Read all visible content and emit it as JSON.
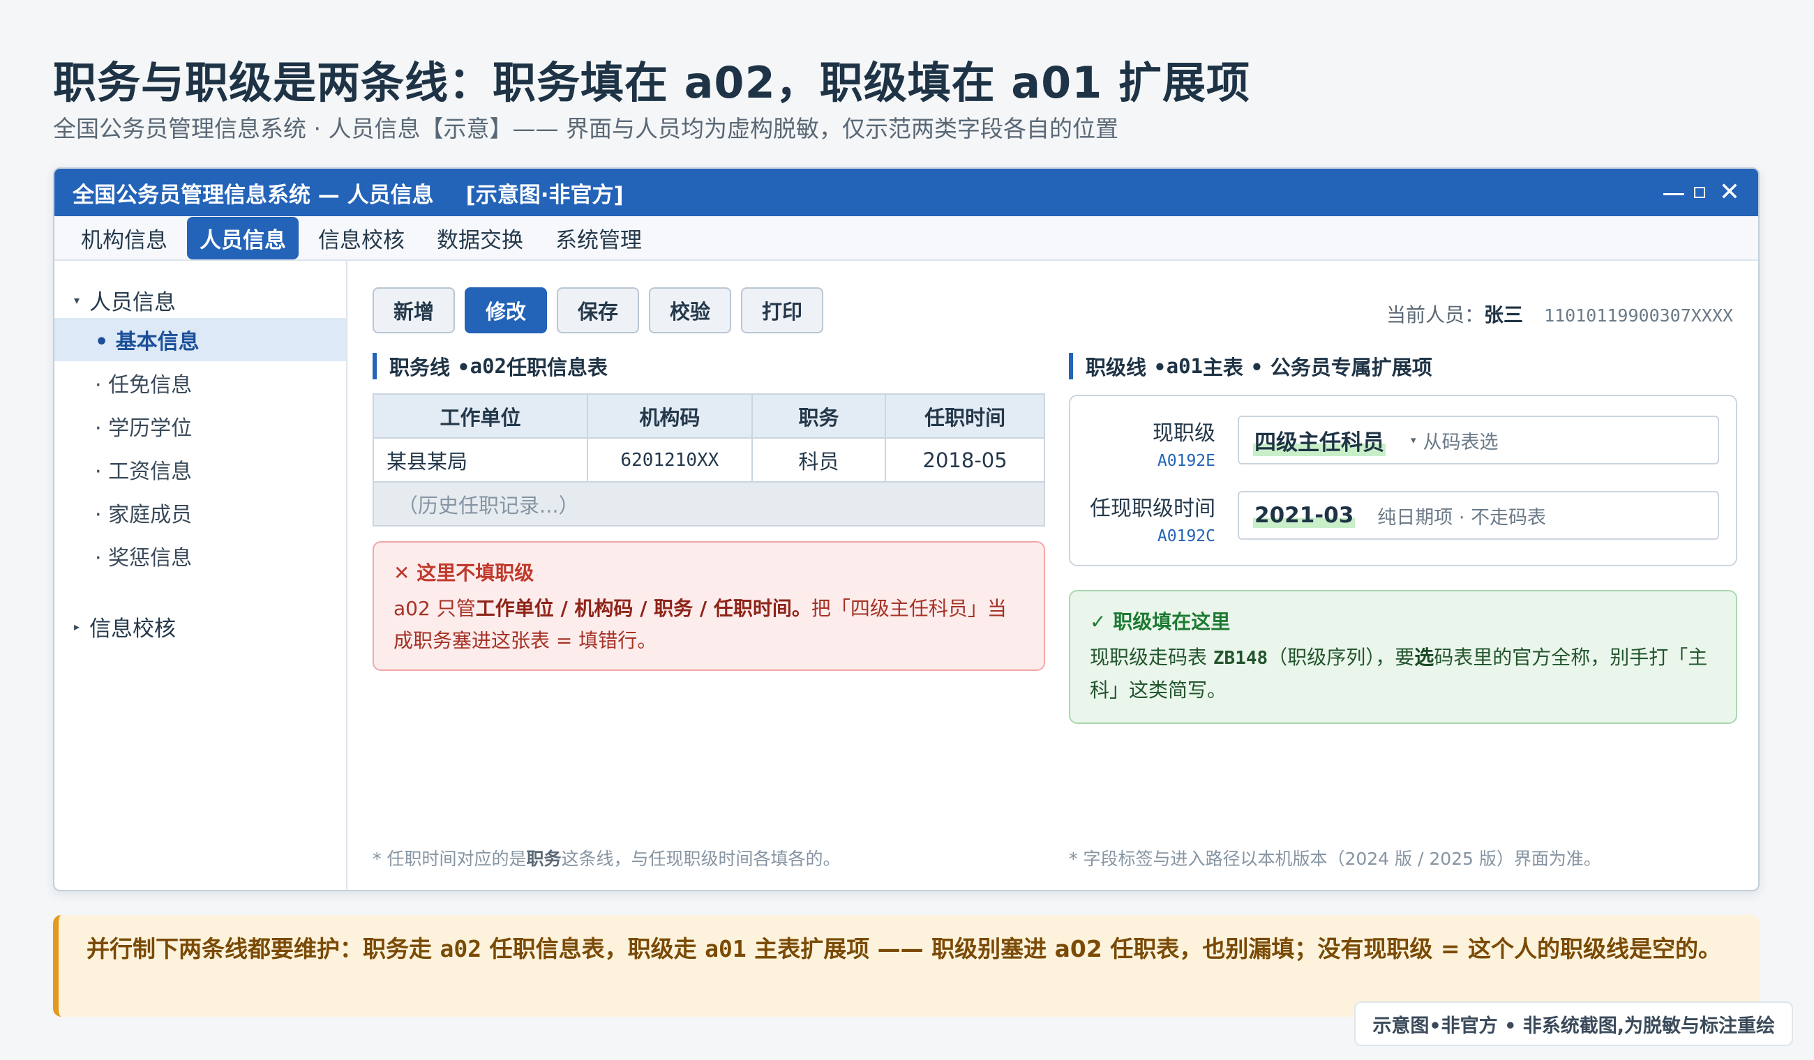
{
  "page": {
    "title": "职务与职级是两条线：职务填在 a02，职级填在 a01 扩展项",
    "subtitle": "全国公务员管理信息系统 · 人员信息【示意】—— 界面与人员均为虚构脱敏，仅示范两类字段各自的位置"
  },
  "window": {
    "title": "全国公务员管理信息系统 — 人员信息",
    "tag": "[示意图·非官方]",
    "close_glyph": "✕"
  },
  "menu": {
    "items": [
      "机构信息",
      "人员信息",
      "信息校核",
      "数据交换",
      "系统管理"
    ],
    "active_index": 1
  },
  "sidebar": {
    "root1": "人员信息",
    "children": [
      "• 基本信息",
      "· 任免信息",
      "· 学历学位",
      "· 工资信息",
      "· 家庭成员",
      "· 奖惩信息"
    ],
    "active_index": 0,
    "root2": "信息校核",
    "caret_open": "▾",
    "caret_closed": "▸"
  },
  "toolbar": {
    "buttons": [
      "新增",
      "修改",
      "保存",
      "校验",
      "打印"
    ],
    "primary_index": 1
  },
  "current_person": {
    "label": "当前人员：",
    "name": "张三",
    "id": "11010119900307XXXX"
  },
  "left_panel": {
    "section_prefix": "职务线 • ",
    "section_code": "a02",
    "section_suffix": " 任职信息表",
    "table": {
      "headers": [
        "工作单位",
        "机构码",
        "职务",
        "任职时间"
      ],
      "row": [
        "某县某局",
        "6201210XX",
        "科员",
        "2018-05"
      ],
      "history": "（历史任职记录...）"
    },
    "warning": {
      "title": "✕ 这里不填职级",
      "text_1": "a02 只管",
      "text_bold": "工作单位 / 机构码 / 职务 / 任职时间。",
      "text_2": "把「四级主任科员」当成职务塞进这张表 = 填错行。"
    },
    "footnote_1": "* 任职时间对应的是",
    "footnote_bold": "职务",
    "footnote_2": "这条线，与任现职级时间各填各的。"
  },
  "right_panel": {
    "section_prefix": "职级线 • ",
    "section_code": "a01",
    "section_suffix": " 主表 • 公务员专属扩展项",
    "fields": [
      {
        "label": "现职级",
        "code": "A0192E",
        "value": "四级主任科员",
        "hint": "从码表选",
        "dropdown": "▾"
      },
      {
        "label": "任现职级时间",
        "code": "A0192C",
        "value": "2021-03",
        "hint": "纯日期项 · 不走码表"
      }
    ],
    "ok": {
      "title": "✓ 职级填在这里",
      "text_1": "现职级走码表 ",
      "text_code": "ZB148",
      "text_2": "（职级序列），要",
      "text_bold": "选",
      "text_3": "码表里的官方全称，别手打「主科」这类简写。"
    },
    "footnote": "* 字段标签与进入路径以本机版本（2024 版 / 2025 版）界面为准。"
  },
  "banner": {
    "text_1": "并行制下两条线都要维护：职务走 ",
    "code_1": "a02",
    "text_2": " 任职信息表，职级走 ",
    "code_2": "a01",
    "text_3": " 主表扩展项 —— 职级别塞进 a02 任职表，也别漏填；没有现职级 = 这个人的职级线是空的。"
  },
  "disclaimer": "示意图•非官方 • 非系统截图,为脱敏与标注重绘",
  "colors": {
    "accent": "#2363b8",
    "warning": "#c0392b",
    "ok": "#1d7a32",
    "banner_accent": "#e39a1e"
  }
}
